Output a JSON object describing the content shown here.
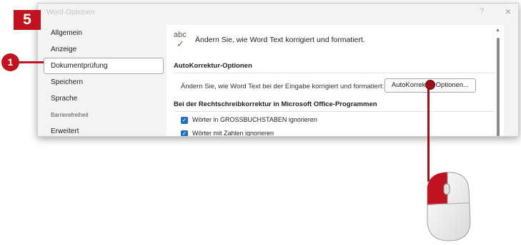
{
  "step_badge": "5",
  "callout_marker": "1",
  "window": {
    "title": "Word-Optionen",
    "help_label": "?",
    "close_label": "×"
  },
  "sidebar": {
    "items": [
      {
        "label": "Allgemein"
      },
      {
        "label": "Anzeige"
      },
      {
        "label": "Dokumentprüfung"
      },
      {
        "label": "Speichern"
      },
      {
        "label": "Sprache"
      },
      {
        "label": "Barrierefreiheit"
      },
      {
        "label": "Erweitert"
      }
    ],
    "active": "Dokumentprüfung"
  },
  "content": {
    "icon_text": "abc",
    "intro": "Ändern Sie, wie Word Text korrigiert und formatiert.",
    "autocorrect_section": "AutoKorrektur-Optionen",
    "autocorrect_text": "Ändern Sie, wie Word Text bei der Eingabe korrigiert und formatiert:",
    "autocorrect_button": "AutoKorrektur-Optionen...",
    "spelling_section": "Bei der Rechtschreibkorrektur in Microsoft Office-Programmen",
    "checkboxes": [
      {
        "label": "Wörter in GROSSBUCHSTABEN ignorieren",
        "checked": true
      },
      {
        "label": "Wörter mit Zahlen ignorieren",
        "checked": true
      }
    ]
  },
  "colors": {
    "callout_red": "#c1121f",
    "checkbox_blue": "#1f6fc4"
  },
  "icons": [
    "abc-check-icon",
    "mouse-icon",
    "close-icon",
    "help-icon",
    "scroll-up-icon"
  ]
}
